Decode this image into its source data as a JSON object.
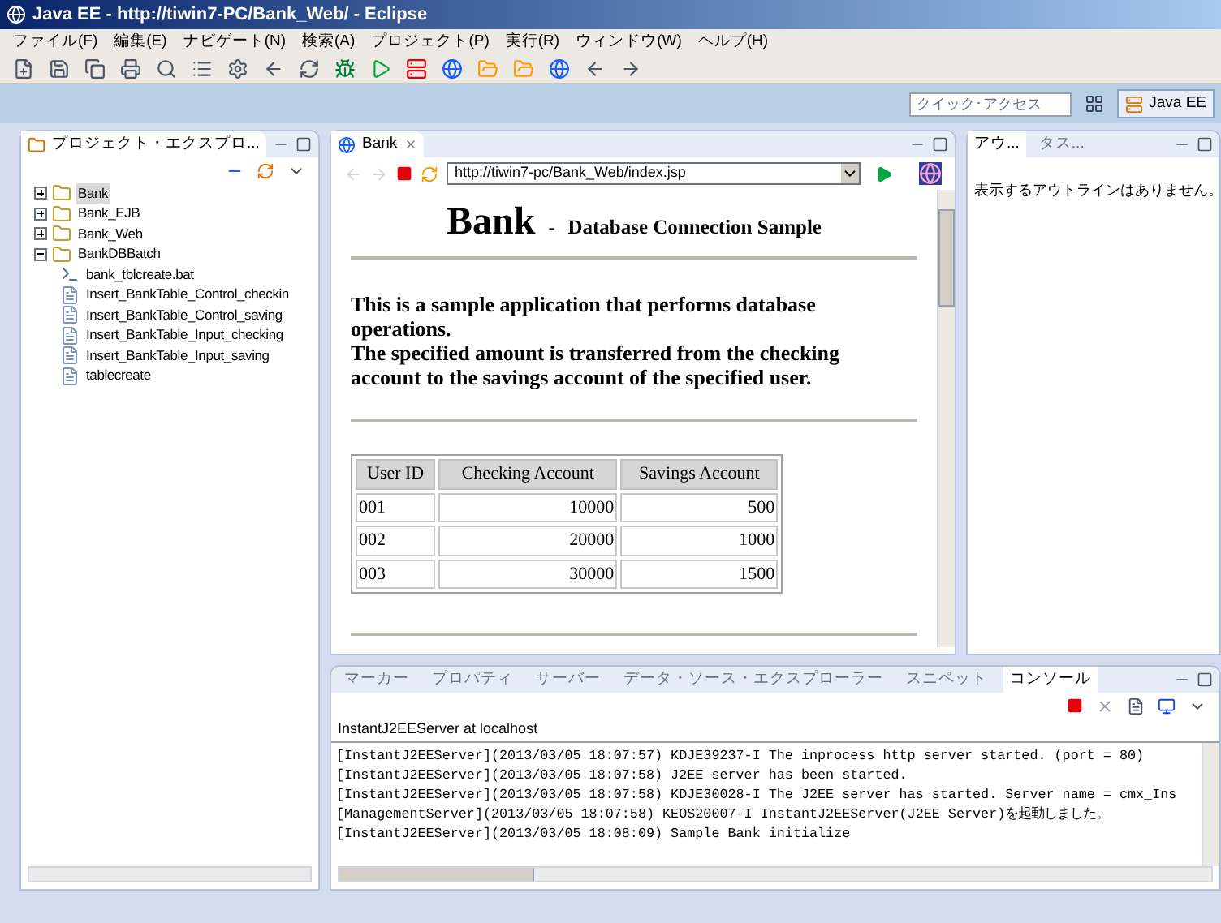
{
  "window": {
    "title": "Java EE - http://tiwin7-PC/Bank_Web/ - Eclipse"
  },
  "menu": [
    "ファイル(F)",
    "編集(E)",
    "ナビゲート(N)",
    "検索(A)",
    "プロジェクト(P)",
    "実行(R)",
    "ウィンドウ(W)",
    "ヘルプ(H)"
  ],
  "quick_access": {
    "placeholder": "クイック･アクセス"
  },
  "perspective": {
    "label": "Java EE",
    "selected": true
  },
  "explorer": {
    "tab": "プロジェクト・エクスプロ...",
    "tree": [
      {
        "label": "Bank",
        "kind": "project",
        "expanded": false,
        "selected": true
      },
      {
        "label": "Bank_EJB",
        "kind": "project",
        "expanded": false,
        "selected": false
      },
      {
        "label": "Bank_Web",
        "kind": "project",
        "expanded": false,
        "selected": false
      },
      {
        "label": "BankDBBatch",
        "kind": "folder",
        "expanded": true,
        "selected": false,
        "children": [
          {
            "label": "bank_tblcreate.bat",
            "kind": "script",
            "selected": false
          },
          {
            "label": "Insert_BankTable_Control_checkin",
            "kind": "file",
            "selected": false
          },
          {
            "label": "Insert_BankTable_Control_saving",
            "kind": "file",
            "selected": false
          },
          {
            "label": "Insert_BankTable_Input_checking",
            "kind": "file",
            "selected": false
          },
          {
            "label": "Insert_BankTable_Input_saving",
            "kind": "file",
            "selected": false
          },
          {
            "label": "tablecreate",
            "kind": "file",
            "selected": false
          }
        ]
      }
    ]
  },
  "editor": {
    "tab": "Bank",
    "url": "http://tiwin7-pc/Bank_Web/index.jsp",
    "page": {
      "heading": "Bank",
      "separator": "-",
      "subheading": "Database Connection Sample",
      "paragraphs": [
        "This is a sample application that performs database operations.",
        "The specified amount is transferred from the checking account to the savings account of the specified user."
      ],
      "table": {
        "columns": [
          "User ID",
          "Checking Account",
          "Savings Account"
        ],
        "rows": [
          [
            "001",
            "10000",
            "500"
          ],
          [
            "002",
            "20000",
            "1000"
          ],
          [
            "003",
            "30000",
            "1500"
          ]
        ]
      }
    }
  },
  "outline": {
    "tabs": [
      {
        "label": "アウ...",
        "selected": true
      },
      {
        "label": "タス...",
        "selected": false
      }
    ],
    "message": "表示するアウトラインはありません。"
  },
  "console": {
    "tabs": [
      {
        "label": "マーカー",
        "selected": false
      },
      {
        "label": "プロパティ",
        "selected": false
      },
      {
        "label": "サーバー",
        "selected": false
      },
      {
        "label": "データ・ソース・エクスプローラー",
        "selected": false
      },
      {
        "label": "スニペット",
        "selected": false
      },
      {
        "label": "コンソール",
        "selected": true
      }
    ],
    "process": "InstantJ2EEServer at localhost",
    "lines": [
      "[InstantJ2EEServer](2013/03/05 18:07:57) KDJE39237-I The inprocess http server started. (port = 80)",
      "[InstantJ2EEServer](2013/03/05 18:07:58) J2EE server has been started.",
      "[InstantJ2EEServer](2013/03/05 18:07:58) KDJE30028-I The J2EE server has started. Server name = cmx_Ins",
      "[ManagementServer](2013/03/05 18:07:58) KEOS20007-I InstantJ2EEServer(J2EE Server)を起動しました。",
      "[InstantJ2EEServer](2013/03/05 18:08:09) Sample Bank initialize"
    ]
  }
}
